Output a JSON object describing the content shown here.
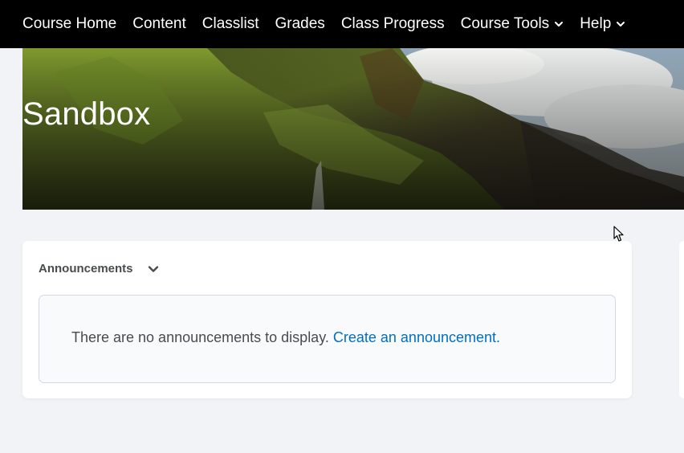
{
  "nav": {
    "items": [
      {
        "label": "Course Home"
      },
      {
        "label": "Content"
      },
      {
        "label": "Classlist"
      },
      {
        "label": "Grades"
      },
      {
        "label": "Class Progress"
      },
      {
        "label": "Course Tools",
        "has_dropdown": true
      },
      {
        "label": "Help",
        "has_dropdown": true
      }
    ]
  },
  "course": {
    "title": "Sandbox"
  },
  "announcements": {
    "heading": "Announcements",
    "empty_message": "There are no announcements to display.",
    "create_link": "Create an announcement."
  }
}
